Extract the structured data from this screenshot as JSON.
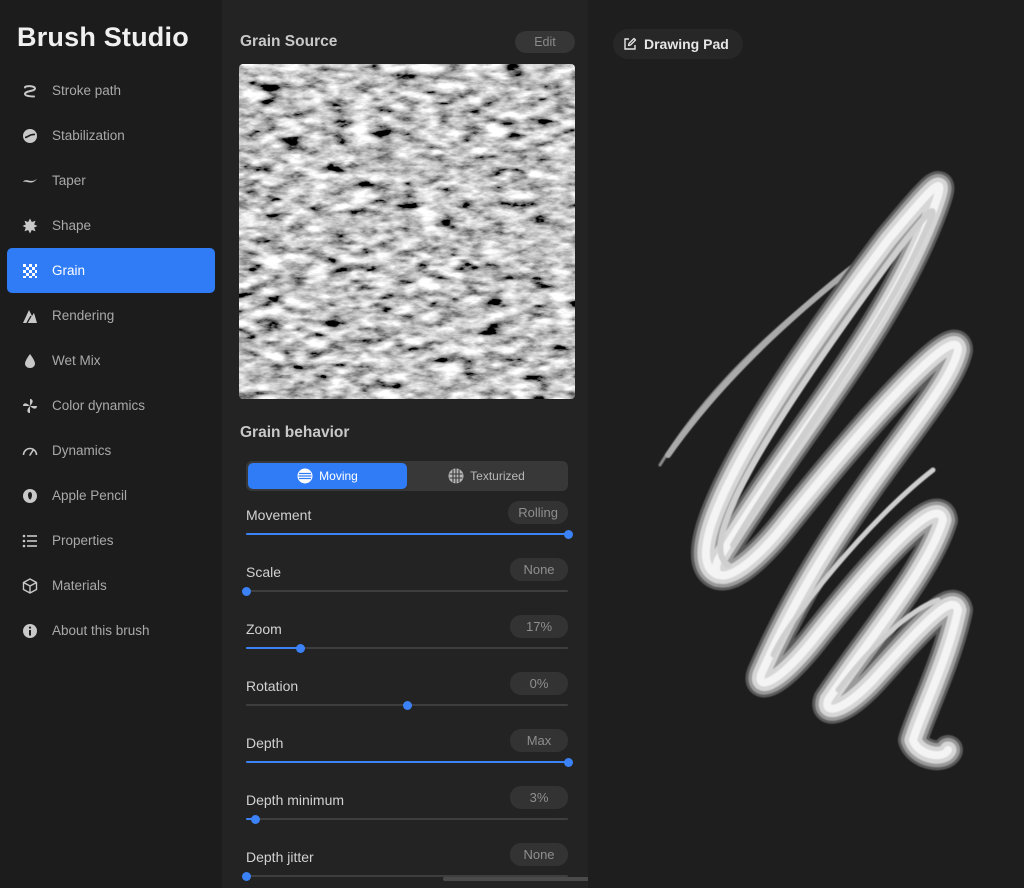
{
  "app": {
    "title": "Brush Studio"
  },
  "sidebar": {
    "items": [
      {
        "label": "Stroke path",
        "icon": "stroke-path-icon"
      },
      {
        "label": "Stabilization",
        "icon": "stabilization-icon"
      },
      {
        "label": "Taper",
        "icon": "taper-icon"
      },
      {
        "label": "Shape",
        "icon": "shape-icon"
      },
      {
        "label": "Grain",
        "icon": "grain-icon",
        "active": true
      },
      {
        "label": "Rendering",
        "icon": "rendering-icon"
      },
      {
        "label": "Wet Mix",
        "icon": "wet-mix-icon"
      },
      {
        "label": "Color dynamics",
        "icon": "color-dynamics-icon"
      },
      {
        "label": "Dynamics",
        "icon": "dynamics-icon"
      },
      {
        "label": "Apple Pencil",
        "icon": "apple-pencil-icon"
      },
      {
        "label": "Properties",
        "icon": "properties-icon"
      },
      {
        "label": "Materials",
        "icon": "materials-icon"
      },
      {
        "label": "About this brush",
        "icon": "info-icon"
      }
    ]
  },
  "grain_source": {
    "title": "Grain Source",
    "edit_label": "Edit"
  },
  "grain_behavior": {
    "title": "Grain behavior",
    "modes": [
      {
        "label": "Moving",
        "icon": "moving-icon",
        "active": true
      },
      {
        "label": "Texturized",
        "icon": "texturized-icon",
        "active": false
      }
    ],
    "sliders": [
      {
        "label": "Movement",
        "value": "Rolling",
        "level": 1.0
      },
      {
        "label": "Scale",
        "value": "None",
        "level": 0.0
      },
      {
        "label": "Zoom",
        "value": "17%",
        "level": 0.17
      },
      {
        "label": "Rotation",
        "value": "0%",
        "level": 0.5
      },
      {
        "label": "Depth",
        "value": "Max",
        "level": 1.0
      },
      {
        "label": "Depth minimum",
        "value": "3%",
        "level": 0.03
      },
      {
        "label": "Depth jitter",
        "value": "None",
        "level": 0.0
      }
    ]
  },
  "drawing_pad": {
    "label": "Drawing Pad",
    "icon": "edit-icon"
  },
  "colors": {
    "accent": "#2f7cf6",
    "sidebar_bg": "#1c1c1c",
    "panel_bg": "#232323",
    "pad_bg": "#1e1e1e"
  }
}
